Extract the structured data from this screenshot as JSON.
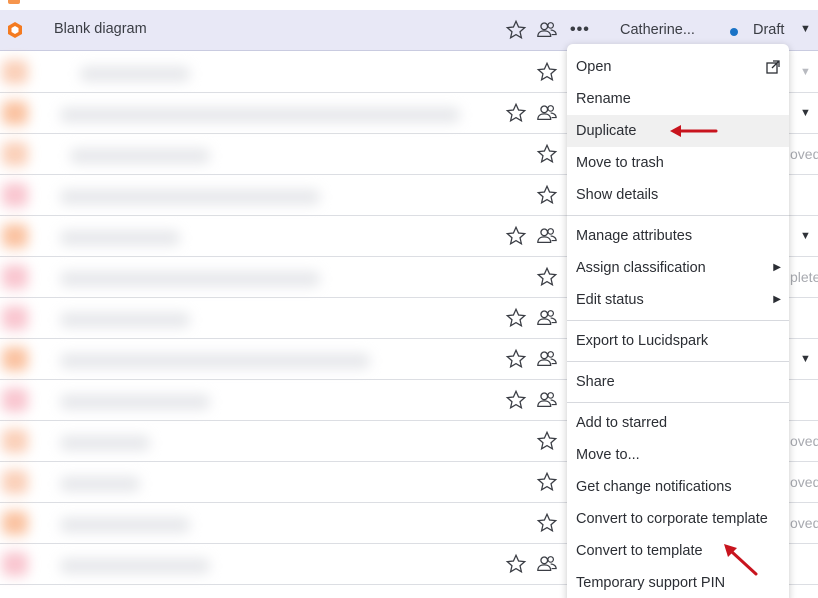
{
  "top_row": {
    "title": "Blank diagram",
    "owner": "Catherine...",
    "status": "Draft",
    "more_label": "•••"
  },
  "menu": {
    "items": [
      {
        "label": "Open"
      },
      {
        "label": "Rename"
      },
      {
        "label": "Duplicate"
      },
      {
        "label": "Move to trash"
      },
      {
        "label": "Show details"
      },
      {
        "label": "Manage attributes"
      },
      {
        "label": "Assign classification"
      },
      {
        "label": "Edit status"
      },
      {
        "label": "Export to Lucidspark"
      },
      {
        "label": "Share"
      },
      {
        "label": "Add to starred"
      },
      {
        "label": "Move to..."
      },
      {
        "label": "Get change notifications"
      },
      {
        "label": "Convert to corporate template"
      },
      {
        "label": "Convert to template"
      },
      {
        "label": "Temporary support PIN"
      }
    ]
  },
  "edge_labels": {
    "r3": "oved",
    "r6": "plete",
    "r10": "oved",
    "r11": "oved",
    "r12": "oved"
  },
  "colors": {
    "highlight_row": "#e8e8f6",
    "annotation_arrow": "#c8141e",
    "status_dot": "#1a73c6",
    "lucid_orange": "#f47a20"
  }
}
